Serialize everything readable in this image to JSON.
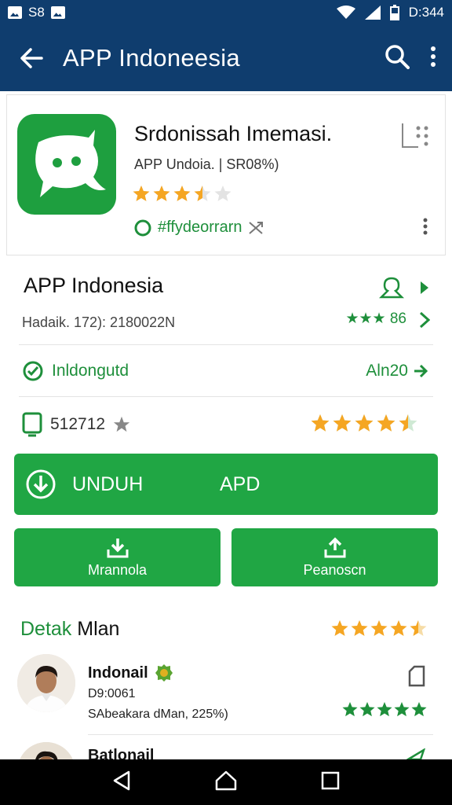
{
  "status_bar": {
    "left_time": "S8",
    "right_time": "D:344"
  },
  "app_bar": {
    "title": "APP Indoneesia"
  },
  "header": {
    "app_name": "Srdonissah Imemasi.",
    "subtitle": "APP Undoia. | SR08%)",
    "rating": 3.5,
    "developer": "#ffydeorrarn"
  },
  "info": {
    "title": "APP Indonesia",
    "subtitle": "Hadaik. 172): 2180022N",
    "rating_text": "★★★ 86"
  },
  "rows": [
    {
      "left_label": "Inldongutd",
      "right_label": "Aln20"
    },
    {
      "left_label": "512712",
      "right_rating": 4.5
    }
  ],
  "buttons": {
    "install_label_1": "UNDUH",
    "install_label_2": "APD",
    "left_label": "Mrannola",
    "right_label": "Peanoscn"
  },
  "reviews": {
    "title_part1": "Detak",
    "title_part2": "Mlan",
    "header_rating": 4.5,
    "items": [
      {
        "name": "Indonail",
        "meta1": "D9:0061",
        "meta2": "SAbeakara dMan, 225%)",
        "rating": 5
      },
      {
        "name": "Batlonail"
      }
    ]
  },
  "colors": {
    "primary": "#0f3d6e",
    "accent": "#20a644",
    "star": "#f5a623"
  }
}
